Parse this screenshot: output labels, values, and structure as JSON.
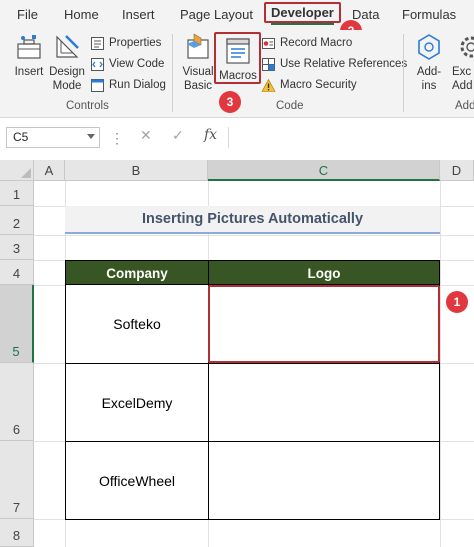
{
  "menu": {
    "tabs": [
      "File",
      "Home",
      "Insert",
      "Page Layout",
      "Developer",
      "Data",
      "Formulas"
    ]
  },
  "ribbon": {
    "controls": {
      "insert": "Insert",
      "design_mode_line1": "Design",
      "design_mode_line2": "Mode",
      "properties": "Properties",
      "view_code": "View Code",
      "run_dialog": "Run Dialog",
      "group_label": "Controls"
    },
    "code": {
      "visual_basic_line1": "Visual",
      "visual_basic_line2": "Basic",
      "macros": "Macros",
      "record_macro": "Record Macro",
      "use_relative_references": "Use Relative References",
      "macro_security": "Macro Security",
      "group_label": "Code"
    },
    "addins": {
      "addins_line1": "Add-",
      "addins_line2": "ins",
      "excel_addins_line1": "Exc",
      "excel_addins_line2": "Add",
      "group_label": "Add"
    }
  },
  "badges": {
    "one": "1",
    "two": "2",
    "three": "3"
  },
  "formula_bar": {
    "name_box": "C5",
    "cancel_symbol": "✕",
    "enter_symbol": "✓",
    "fx_symbol": "fx",
    "value": ""
  },
  "sheet": {
    "columns": [
      "A",
      "B",
      "C",
      "D"
    ],
    "rows": [
      "1",
      "2",
      "3",
      "4",
      "5",
      "6",
      "7",
      "8"
    ],
    "title": "Inserting Pictures Automatically",
    "table": {
      "headers": [
        "Company",
        "Logo"
      ],
      "rows": [
        {
          "company": "Softeko",
          "logo": ""
        },
        {
          "company": "ExcelDemy",
          "logo": ""
        },
        {
          "company": "OfficeWheel",
          "logo": ""
        }
      ]
    }
  },
  "colors": {
    "excel_green": "#217346",
    "table_header_bg": "#375623",
    "highlight_red": "#b23035",
    "badge_red": "#e0383e",
    "title_text": "#44546a",
    "title_underline": "#8ea9db"
  },
  "icons": {
    "insert": "toolbox-icon",
    "design_mode": "ruler-pencil-icon",
    "properties": "properties-icon",
    "view_code": "view-code-icon",
    "run_dialog": "run-dialog-icon",
    "visual_basic": "visual-basic-icon",
    "macros": "macros-icon",
    "record_macro": "record-macro-icon",
    "use_relative_references": "relative-references-icon",
    "macro_security": "warning-icon",
    "addins": "addins-icon",
    "excel_addins": "gear-icon"
  }
}
